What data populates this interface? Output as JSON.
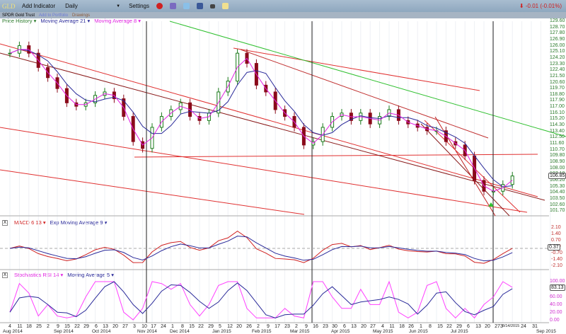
{
  "toolbar": {
    "symbol": "GLD",
    "add_indicator": "Add Indicator",
    "interval": "Daily",
    "interval_arrow": "▼",
    "settings": "Settings",
    "change": "-0.01 (-0.01%)"
  },
  "subbar": {
    "name": "SPDR Gold Trust",
    "add_portfolio": "Add to Portfolio",
    "drawings": "Drawings"
  },
  "price_legend": {
    "price": "Price History ▾",
    "ma21": "Moving Average 21 ▾",
    "ma8": "Moving Average 8 ▾"
  },
  "macd_legend": {
    "close": "X",
    "macd": "MACD 6 13 ▾",
    "ema": "Exp Moving Average 9 ▾"
  },
  "stoch_legend": {
    "close": "X",
    "stoch": "Stochastics RSI 14 ▾",
    "ma": "Moving Average 5 ▾"
  },
  "colors": {
    "ma21": "#2a2a9a",
    "ma8": "#e020e0",
    "up": "#1a7a1a",
    "down": "#8a0a1a",
    "macd": "#d02020",
    "signal": "#2a2a9a",
    "trend": "#e03030",
    "green_trend": "#30c030"
  },
  "price_axis": {
    "ticks": [
      "129.60",
      "128.70",
      "127.80",
      "126.90",
      "126.00",
      "125.10",
      "124.20",
      "123.30",
      "122.40",
      "121.50",
      "120.60",
      "119.70",
      "118.80",
      "117.90",
      "117.00",
      "116.10",
      "115.20",
      "114.30",
      "113.40",
      "112.50",
      "111.60",
      "110.70",
      "109.80",
      "108.90",
      "108.00",
      "107.10",
      "106.20",
      "105.30",
      "104.40",
      "103.50",
      "102.60",
      "101.70"
    ],
    "last": "106.85"
  },
  "macd_axis": {
    "ticks": [
      "2.10",
      "1.40",
      "0.70",
      "0.00",
      "-0.70",
      "-1.40",
      "-2.10"
    ],
    "last": "0.37"
  },
  "stoch_axis": {
    "ticks": [
      "100.00",
      "80.00",
      "60.00",
      "40.00",
      "20.00",
      "0.00"
    ],
    "last": "83.13"
  },
  "date_axis": {
    "days": [
      "4",
      "11",
      "18",
      "25",
      "2",
      "9",
      "15",
      "22",
      "29",
      "6",
      "13",
      "20",
      "27",
      "3",
      "10",
      "17",
      "24",
      "1",
      "8",
      "15",
      "22",
      "29",
      "5",
      "12",
      "20",
      "26",
      "2",
      "9",
      "17",
      "23",
      "2",
      "9",
      "16",
      "23",
      "30",
      "6",
      "13",
      "20",
      "27",
      "4",
      "11",
      "18",
      "26",
      "1",
      "8",
      "15",
      "22",
      "29",
      "6",
      "13",
      "20",
      "27",
      "3",
      "8/14/2015",
      "24",
      "31"
    ],
    "months": [
      "Aug 2014",
      "Sep 2014",
      "Oct 2014",
      "Nov 2014",
      "Dec 2014",
      "Jan 2015",
      "Feb 2015",
      "Mar 2015",
      "Apr 2015",
      "May 2015",
      "Jun 2015",
      "Jul 2015",
      "Sep 2015"
    ]
  },
  "chart_data": {
    "type": "candlestick",
    "symbol": "GLD",
    "interval": "weekly-sampled",
    "price": [
      124.9,
      126.0,
      124.9,
      122.8,
      121.3,
      119.7,
      117.6,
      117.1,
      117.6,
      118.7,
      119.2,
      118.2,
      115.6,
      111.9,
      110.9,
      114.0,
      115.6,
      116.6,
      117.6,
      115.6,
      115.0,
      116.1,
      119.2,
      120.8,
      124.9,
      123.4,
      120.2,
      119.2,
      116.6,
      115.6,
      114.0,
      111.4,
      111.9,
      114.0,
      115.6,
      116.1,
      115.0,
      116.1,
      114.5,
      115.6,
      116.6,
      115.0,
      114.5,
      114.0,
      113.5,
      113.5,
      111.9,
      111.4,
      109.8,
      106.2,
      104.6,
      104.6,
      105.6,
      106.85
    ],
    "stoch_rsi": [
      20,
      95,
      70,
      10,
      40,
      10,
      5,
      10,
      60,
      100,
      100,
      100,
      20,
      0,
      30,
      100,
      95,
      80,
      95,
      40,
      10,
      40,
      90,
      100,
      100,
      30,
      5,
      5,
      5,
      30,
      10,
      5,
      100,
      100,
      60,
      30,
      30,
      80,
      40,
      40,
      100,
      20,
      5,
      20,
      90,
      100,
      30,
      5,
      30,
      5,
      40,
      60,
      100,
      85
    ],
    "ylim": [
      101.7,
      129.6
    ]
  }
}
